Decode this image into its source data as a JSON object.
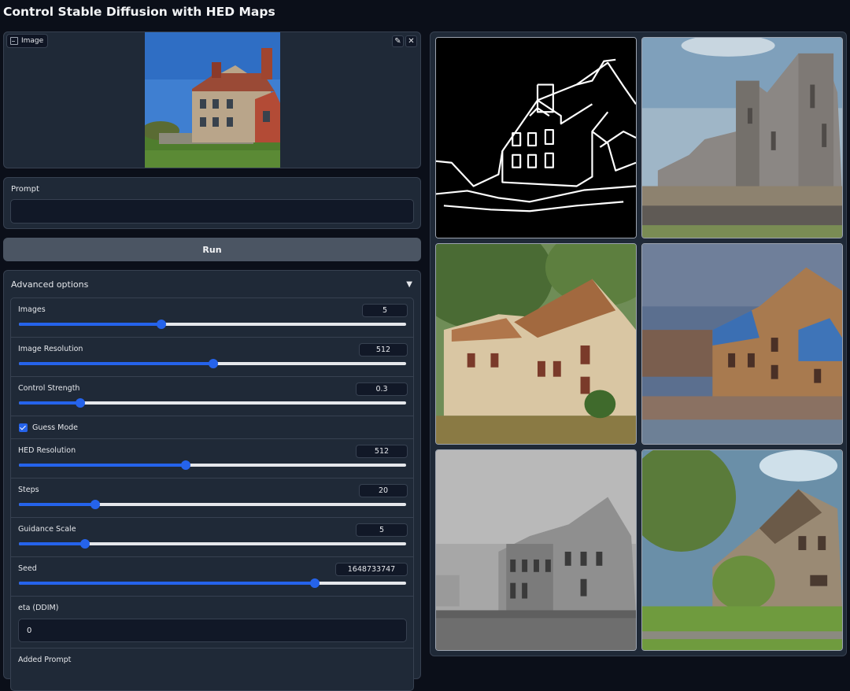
{
  "page": {
    "title": "Control Stable Diffusion with HED Maps"
  },
  "image_input": {
    "label": "Image",
    "edit_icon": "pencil-icon",
    "close_icon": "close-icon"
  },
  "prompt": {
    "label": "Prompt",
    "value": ""
  },
  "run": {
    "label": "Run"
  },
  "advanced": {
    "label": "Advanced options",
    "images": {
      "label": "Images",
      "value": "5",
      "fraction": 0.368
    },
    "image_resolution": {
      "label": "Image Resolution",
      "value": "512",
      "fraction": 0.502
    },
    "control_strength": {
      "label": "Control Strength",
      "value": "0.3",
      "fraction": 0.158
    },
    "guess_mode": {
      "label": "Guess Mode",
      "checked": true
    },
    "hed_resolution": {
      "label": "HED Resolution",
      "value": "512",
      "fraction": 0.431
    },
    "steps": {
      "label": "Steps",
      "value": "20",
      "fraction": 0.198
    },
    "guidance_scale": {
      "label": "Guidance Scale",
      "value": "5",
      "fraction": 0.171
    },
    "seed": {
      "label": "Seed",
      "value": "1648733747",
      "fraction": 0.764
    },
    "eta": {
      "label": "eta (DDIM)",
      "value": "0"
    },
    "added_prompt": {
      "label": "Added Prompt"
    }
  },
  "colors": {
    "accent": "#2563eb",
    "background": "#0b0f19",
    "panel": "#1f2937"
  }
}
